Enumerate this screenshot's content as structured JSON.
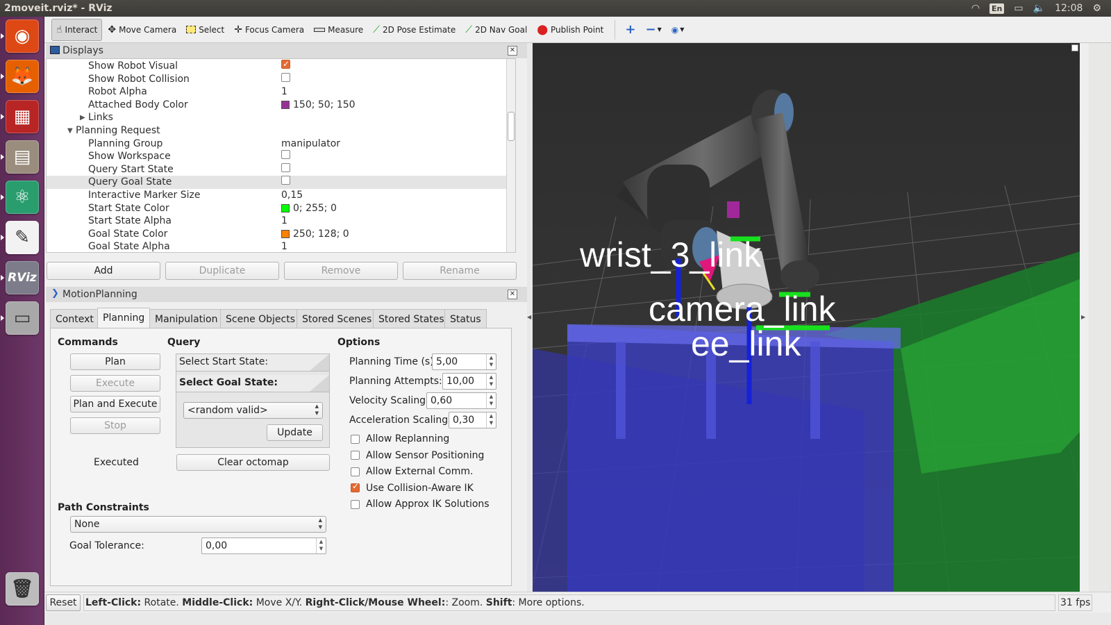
{
  "window": {
    "title": "2moveit.rviz* - RViz"
  },
  "system": {
    "keyboard": "En",
    "clock": "12:08"
  },
  "launcher": {
    "items": [
      {
        "name": "ubuntu-dash-icon",
        "color": "#dd4814",
        "glyph": "◉"
      },
      {
        "name": "firefox-icon",
        "color": "#e66000",
        "glyph": "🦊"
      },
      {
        "name": "workspaces-icon",
        "color": "#b82525",
        "glyph": "▦"
      },
      {
        "name": "files-icon",
        "color": "#9a8d7e",
        "glyph": "▤"
      },
      {
        "name": "atom-icon",
        "color": "#2a9d6f",
        "glyph": "⚛"
      },
      {
        "name": "text-editor-icon",
        "color": "#f2f2f2",
        "glyph": "✎"
      },
      {
        "name": "rviz-icon",
        "color": "#7c7c8a",
        "glyph": "RViz"
      },
      {
        "name": "drive-icon",
        "color": "#a8a8a8",
        "glyph": "▭"
      },
      {
        "name": "trash-icon",
        "color": "#bcbcbc",
        "glyph": "🗑"
      }
    ]
  },
  "toolbar": {
    "interact": "Interact",
    "move_camera": "Move Camera",
    "select": "Select",
    "focus_camera": "Focus Camera",
    "measure": "Measure",
    "pose_estimate": "2D Pose Estimate",
    "nav_goal": "2D Nav Goal",
    "publish_point": "Publish Point"
  },
  "displays": {
    "title": "Displays",
    "rows": [
      {
        "key": "Show Robot Visual",
        "type": "check",
        "checked": true
      },
      {
        "key": "Show Robot Collision",
        "type": "check",
        "checked": false
      },
      {
        "key": "Robot Alpha",
        "type": "text",
        "value": "1"
      },
      {
        "key": "Attached Body Color",
        "type": "color",
        "color": "#963296",
        "value": "150; 50; 150"
      },
      {
        "key": "Links",
        "type": "group",
        "expanded": false
      },
      {
        "key": "Planning Request",
        "type": "group",
        "expanded": true
      },
      {
        "key": "Planning Group",
        "type": "text",
        "value": "manipulator"
      },
      {
        "key": "Show Workspace",
        "type": "check",
        "checked": false
      },
      {
        "key": "Query Start State",
        "type": "check",
        "checked": false
      },
      {
        "key": "Query Goal State",
        "type": "check",
        "checked": false
      },
      {
        "key": "Interactive Marker Size",
        "type": "text",
        "value": "0,15"
      },
      {
        "key": "Start State Color",
        "type": "color",
        "color": "#00ff00",
        "value": "0; 255; 0"
      },
      {
        "key": "Start State Alpha",
        "type": "text",
        "value": "1"
      },
      {
        "key": "Goal State Color",
        "type": "color",
        "color": "#fa8000",
        "value": "250; 128; 0"
      },
      {
        "key": "Goal State Alpha",
        "type": "text",
        "value": "1"
      }
    ],
    "buttons": {
      "add": "Add",
      "duplicate": "Duplicate",
      "remove": "Remove",
      "rename": "Rename"
    }
  },
  "motion": {
    "title": "MotionPlanning",
    "tabs": [
      "Context",
      "Planning",
      "Manipulation",
      "Scene Objects",
      "Stored Scenes",
      "Stored States",
      "Status"
    ],
    "active_tab": "Planning",
    "commands": {
      "heading": "Commands",
      "plan": "Plan",
      "execute": "Execute",
      "plan_execute": "Plan and Execute",
      "stop": "Stop",
      "status": "Executed"
    },
    "query": {
      "heading": "Query",
      "start": "Select Start State:",
      "goal": "Select Goal State:",
      "goal_value": "<random valid>",
      "update": "Update",
      "clear": "Clear octomap"
    },
    "options": {
      "heading": "Options",
      "planning_time_label": "Planning Time (s):",
      "planning_time": "5,00",
      "attempts_label": "Planning Attempts:",
      "attempts": "10,00",
      "velocity_label": "Velocity Scaling:",
      "velocity": "0,60",
      "accel_label": "Acceleration Scaling:",
      "accel": "0,30",
      "checks": [
        {
          "label": "Allow Replanning",
          "checked": false
        },
        {
          "label": "Allow Sensor Positioning",
          "checked": false
        },
        {
          "label": "Allow External Comm.",
          "checked": false
        },
        {
          "label": "Use Collision-Aware IK",
          "checked": true
        },
        {
          "label": "Allow Approx IK Solutions",
          "checked": false
        }
      ]
    },
    "path": {
      "heading": "Path Constraints",
      "value": "None",
      "tolerance_label": "Goal Tolerance:",
      "tolerance": "0,00"
    }
  },
  "view3d": {
    "labels": {
      "wrist": "wrist_3_link",
      "camera": "camera_link",
      "ee": "ee_link"
    }
  },
  "status": {
    "reset": "Reset",
    "left_click": "Left-Click:",
    "left_desc": " Rotate. ",
    "middle_click": "Middle-Click:",
    "middle_desc": " Move X/Y. ",
    "right_click": "Right-Click/Mouse Wheel:",
    "right_desc": ": Zoom. ",
    "shift": "Shift",
    "shift_desc": ": More options.",
    "fps": "31 fps"
  }
}
